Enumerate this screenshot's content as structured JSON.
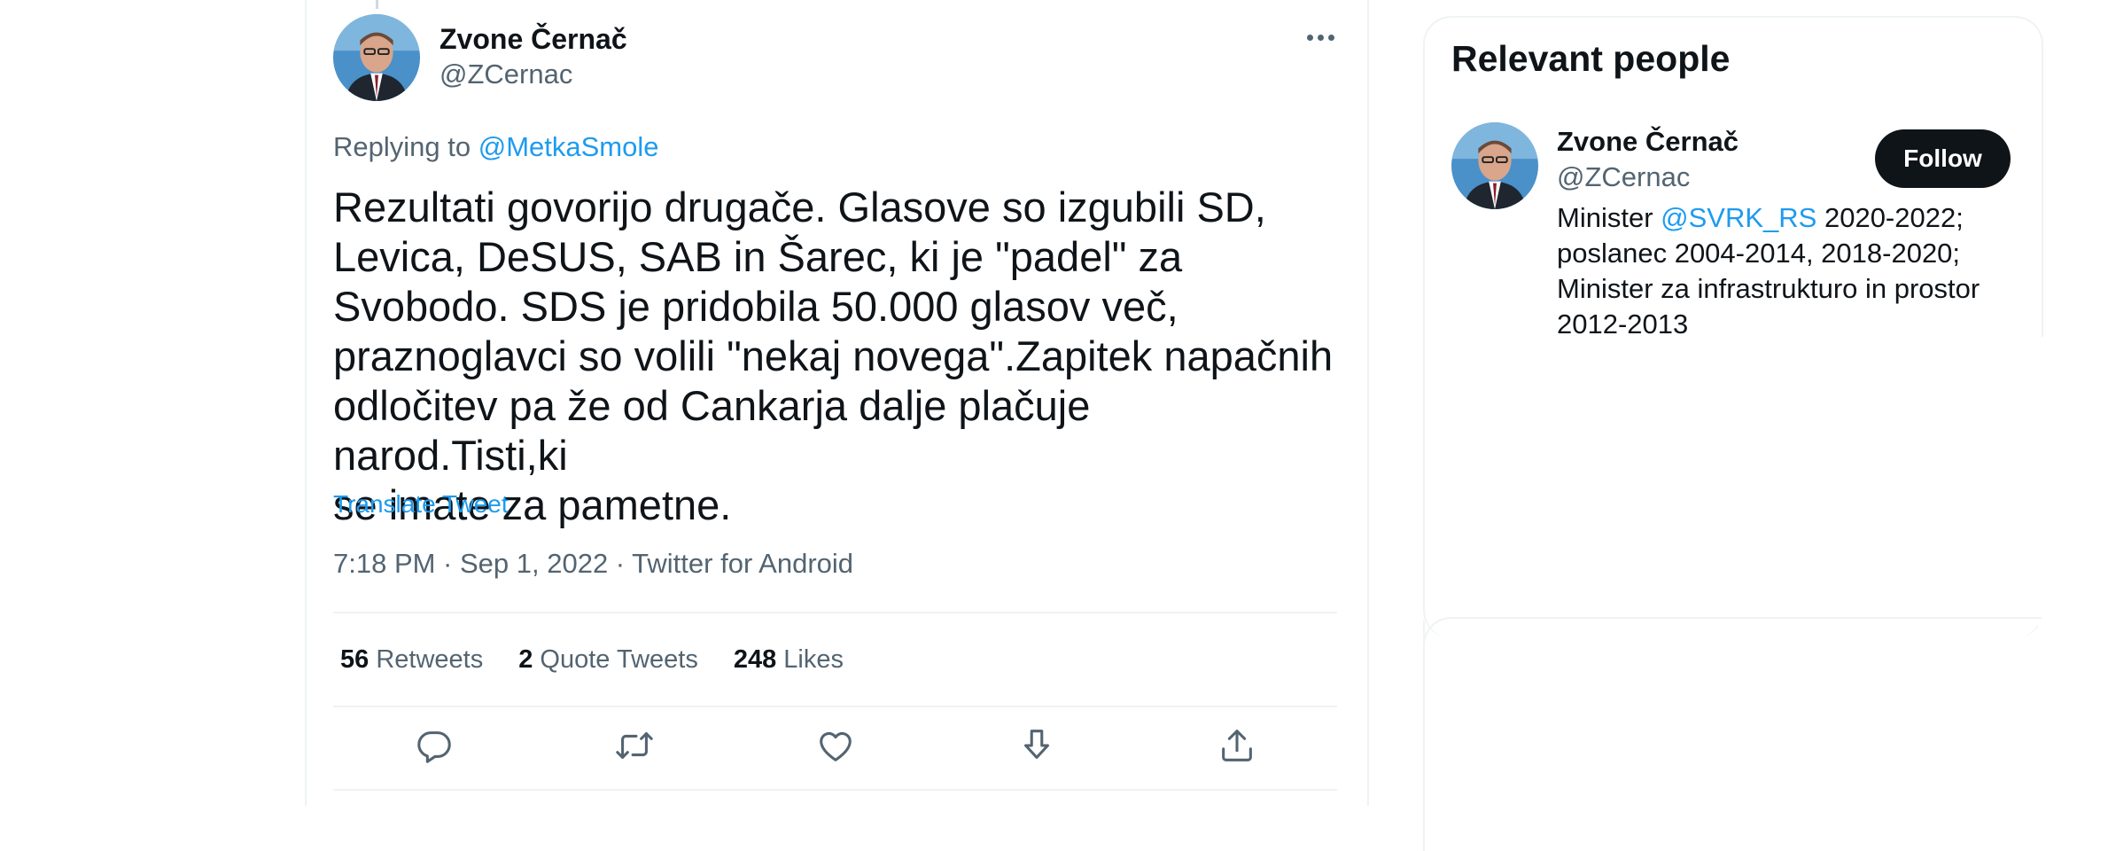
{
  "tweet": {
    "author_name": "Zvone Černač",
    "author_handle": "@ZCernac",
    "replying_prefix": "Replying to",
    "replying_mention": "@MetkaSmole",
    "text": "Rezultati govorijo drugače. Glasove so izgubili SD,\nLevica, DeSUS, SAB in Šarec, ki je \"padel\" za\nSvobodo. SDS je pridobila 50.000 glasov več,\npraznoglavci so volili \"nekaj novega\".Zapitek napačnih\nodločitev pa že od Cankarja dalje plačuje narod.Tisti,ki\nse imate za pametne.",
    "translate_label": "Translate Tweet",
    "timestamp": "7:18 PM · Sep 1, 2022 · Twitter for Android",
    "stats": [
      {
        "count": "56",
        "label": "Retweets"
      },
      {
        "count": "2",
        "label": "Quote Tweets"
      },
      {
        "count": "248",
        "label": "Likes"
      }
    ],
    "actions": [
      "reply-icon",
      "retweet-icon",
      "like-icon",
      "download-icon",
      "share-icon"
    ]
  },
  "relevant_people": {
    "title": "Relevant people",
    "person": {
      "name": "Zvone Černač",
      "handle": "@ZCernac",
      "follow_label": "Follow",
      "bio_prefix": "Minister",
      "bio_mention": "@SVRK_RS",
      "bio_rest": "2020-2022; poslanec 2004-2014, 2018-2020; Minister za infrastrukturo in prostor 2012-2013"
    }
  },
  "colors": {
    "accent": "#1d9bf0",
    "text": "#0f1419",
    "secondary_text": "#536471",
    "border": "#eff3f4",
    "button_bg": "#0f1419"
  }
}
